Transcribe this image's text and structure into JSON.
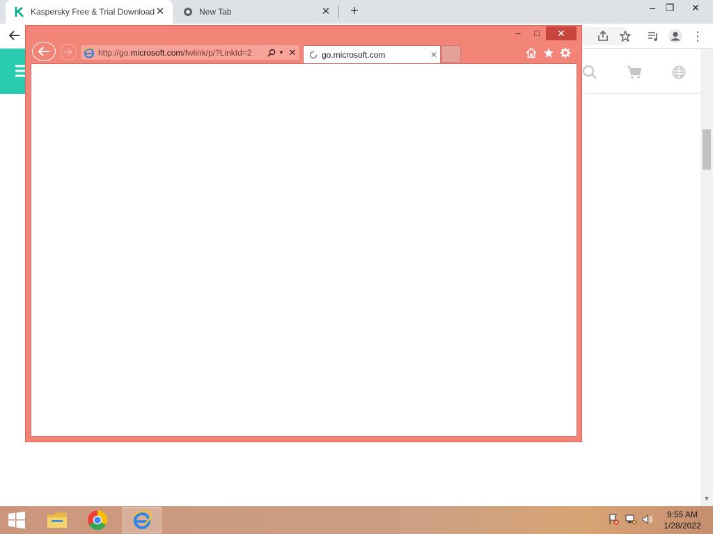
{
  "chrome": {
    "tabs": [
      {
        "title": "Kaspersky Free & Trial Download",
        "active": true
      },
      {
        "title": "New Tab",
        "active": false
      }
    ],
    "new_tab_label": "+",
    "window_controls": {
      "minimize": "–",
      "restore": "❐",
      "close": "✕"
    }
  },
  "ie": {
    "url_prefix": "http://go.",
    "url_domain": "microsoft.com",
    "url_suffix": "/fwlink/p/?LinkId=2",
    "tab_title": "go.microsoft.com",
    "window_controls": {
      "minimize": "–",
      "maximize": "□",
      "close": "✕"
    },
    "colors": {
      "frame": "#f28478",
      "close": "#c7463d"
    }
  },
  "taskbar": {
    "apps": [
      "file-explorer",
      "google-chrome",
      "internet-explorer"
    ],
    "clock_time": "9:55 AM",
    "clock_date": "1/28/2022"
  },
  "colors": {
    "kaspersky_accent": "#29ccb1"
  }
}
